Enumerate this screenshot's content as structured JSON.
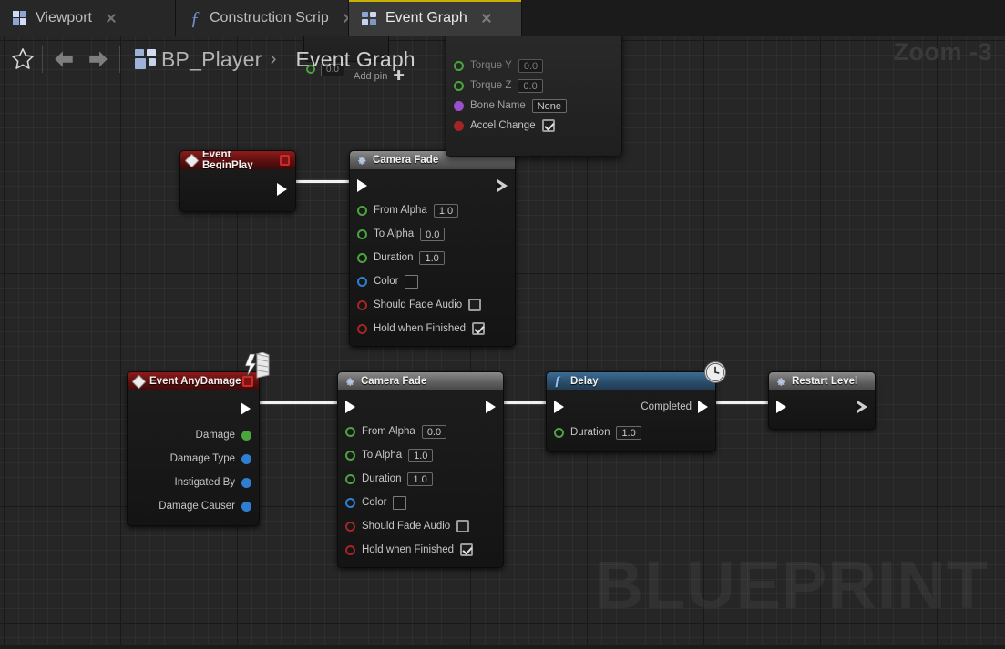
{
  "window": {
    "zoom_indicator": "Zoom -3",
    "watermark": "BLUEPRINT"
  },
  "tabs": [
    {
      "label": "Viewport",
      "icon": "viewport-icon",
      "active": false
    },
    {
      "label": "Construction Scrip",
      "icon": "function-icon",
      "active": false
    },
    {
      "label": "Event Graph",
      "icon": "event-graph-icon",
      "active": true
    }
  ],
  "breadcrumb": {
    "star_icon": "favorite-star-icon",
    "back_icon": "back-arrow-icon",
    "forward_icon": "forward-arrow-icon",
    "graph_icon": "blueprint-icon",
    "blueprint_name": "BP_Player",
    "separator": "›",
    "graph_name": "Event Graph"
  },
  "partial_node": {
    "rows": [
      {
        "label": "Torque Y",
        "pin_color": "green",
        "control": "value",
        "value": "0.0"
      },
      {
        "label": "Torque Z",
        "pin_color": "green",
        "control": "value",
        "value": "0.0"
      },
      {
        "label": "Bone Name",
        "pin_color": "purple",
        "control": "value",
        "value": "None"
      },
      {
        "label": "Accel Change",
        "pin_color": "red",
        "control": "checkbox",
        "checked": true
      }
    ],
    "add_pin_label": "Add pin",
    "add_pin_glyph": "✚",
    "stray_value": "0.0"
  },
  "nodes": [
    {
      "id": "event-beginplay",
      "title": "Event BeginPlay",
      "header_style": "red",
      "icon": "event-diamond-icon",
      "has_delegate_pin": true,
      "exec_out_label": "",
      "pins": []
    },
    {
      "id": "camera-fade-1",
      "title": "Camera Fade",
      "header_style": "grey",
      "icon": "gear-icon",
      "pins": [
        {
          "label": "From Alpha",
          "pin_color": "green",
          "control": "value",
          "value": "1.0"
        },
        {
          "label": "To Alpha",
          "pin_color": "green",
          "control": "value",
          "value": "0.0"
        },
        {
          "label": "Duration",
          "pin_color": "green",
          "control": "value",
          "value": "1.0"
        },
        {
          "label": "Color",
          "pin_color": "blue",
          "control": "color",
          "value": "#151515"
        },
        {
          "label": "Should Fade Audio",
          "pin_color": "red",
          "control": "checkbox",
          "checked": false
        },
        {
          "label": "Hold when Finished",
          "pin_color": "red",
          "control": "checkbox",
          "checked": true
        }
      ]
    },
    {
      "id": "event-anydamage",
      "title": "Event AnyDamage",
      "header_style": "red",
      "icon": "event-diamond-icon",
      "badge": "server-replication-icon",
      "has_delegate_pin": true,
      "output_pins": [
        {
          "label": "Damage",
          "pin_color": "green"
        },
        {
          "label": "Damage Type",
          "pin_color": "blue"
        },
        {
          "label": "Instigated By",
          "pin_color": "blue"
        },
        {
          "label": "Damage Causer",
          "pin_color": "blue"
        }
      ]
    },
    {
      "id": "camera-fade-2",
      "title": "Camera Fade",
      "header_style": "grey",
      "icon": "gear-icon",
      "pins": [
        {
          "label": "From Alpha",
          "pin_color": "green",
          "control": "value",
          "value": "0.0"
        },
        {
          "label": "To Alpha",
          "pin_color": "green",
          "control": "value",
          "value": "1.0"
        },
        {
          "label": "Duration",
          "pin_color": "green",
          "control": "value",
          "value": "1.0"
        },
        {
          "label": "Color",
          "pin_color": "blue",
          "control": "color",
          "value": "#151515"
        },
        {
          "label": "Should Fade Audio",
          "pin_color": "red",
          "control": "checkbox",
          "checked": false
        },
        {
          "label": "Hold when Finished",
          "pin_color": "red",
          "control": "checkbox",
          "checked": true
        }
      ]
    },
    {
      "id": "delay",
      "title": "Delay",
      "header_style": "blue",
      "icon": "function-icon",
      "badge": "latent-clock-icon",
      "exec_out_label": "Completed",
      "pins": [
        {
          "label": "Duration",
          "pin_color": "green",
          "control": "value",
          "value": "1.0"
        }
      ]
    },
    {
      "id": "restart-level",
      "title": "Restart Level",
      "header_style": "grey",
      "icon": "gear-icon",
      "pins": []
    }
  ],
  "colors": {
    "canvas_bg": "#262626",
    "exec_wire": "#f2f2f2",
    "tab_active_underline": "#c8b100",
    "header_red": "#5c0f0f",
    "header_grey": "#5c5c5c",
    "header_blue": "#2a4d6b",
    "pin_exec": "#ffffff",
    "pin_float": "#4ba53e",
    "pin_object": "#2f7fd0",
    "pin_bool": "#a52525",
    "pin_name": "#9b4fd0"
  }
}
